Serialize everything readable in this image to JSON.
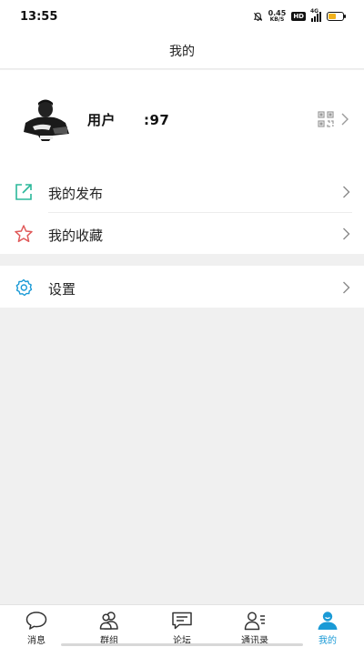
{
  "status_bar": {
    "time": "13:55",
    "net_speed_value": "0.45",
    "net_speed_unit": "KB/S",
    "hd_label": "HD",
    "signal_label": "4G",
    "battery_level": 0.5,
    "battery_color": "#f2b21b"
  },
  "header": {
    "title": "我的"
  },
  "profile": {
    "username": "用户　　:97",
    "avatar_icon": "user-photo",
    "qr_icon": "qr-code-icon"
  },
  "menu": {
    "items": [
      {
        "label": "我的发布",
        "icon": "share-out-icon",
        "icon_color": "#2bb89a"
      },
      {
        "label": "我的收藏",
        "icon": "star-icon",
        "icon_color": "#e05a5a"
      }
    ],
    "settings": {
      "label": "设置",
      "icon": "gear-icon",
      "icon_color": "#1a9ad6"
    }
  },
  "tabs": [
    {
      "label": "消息",
      "icon": "chat-bubble-icon",
      "active": false
    },
    {
      "label": "群组",
      "icon": "group-icon",
      "active": false
    },
    {
      "label": "论坛",
      "icon": "forum-icon",
      "active": false
    },
    {
      "label": "通讯录",
      "icon": "contacts-icon",
      "active": false
    },
    {
      "label": "我的",
      "icon": "profile-icon",
      "active": true
    }
  ],
  "accent_color": "#1a9ad6"
}
